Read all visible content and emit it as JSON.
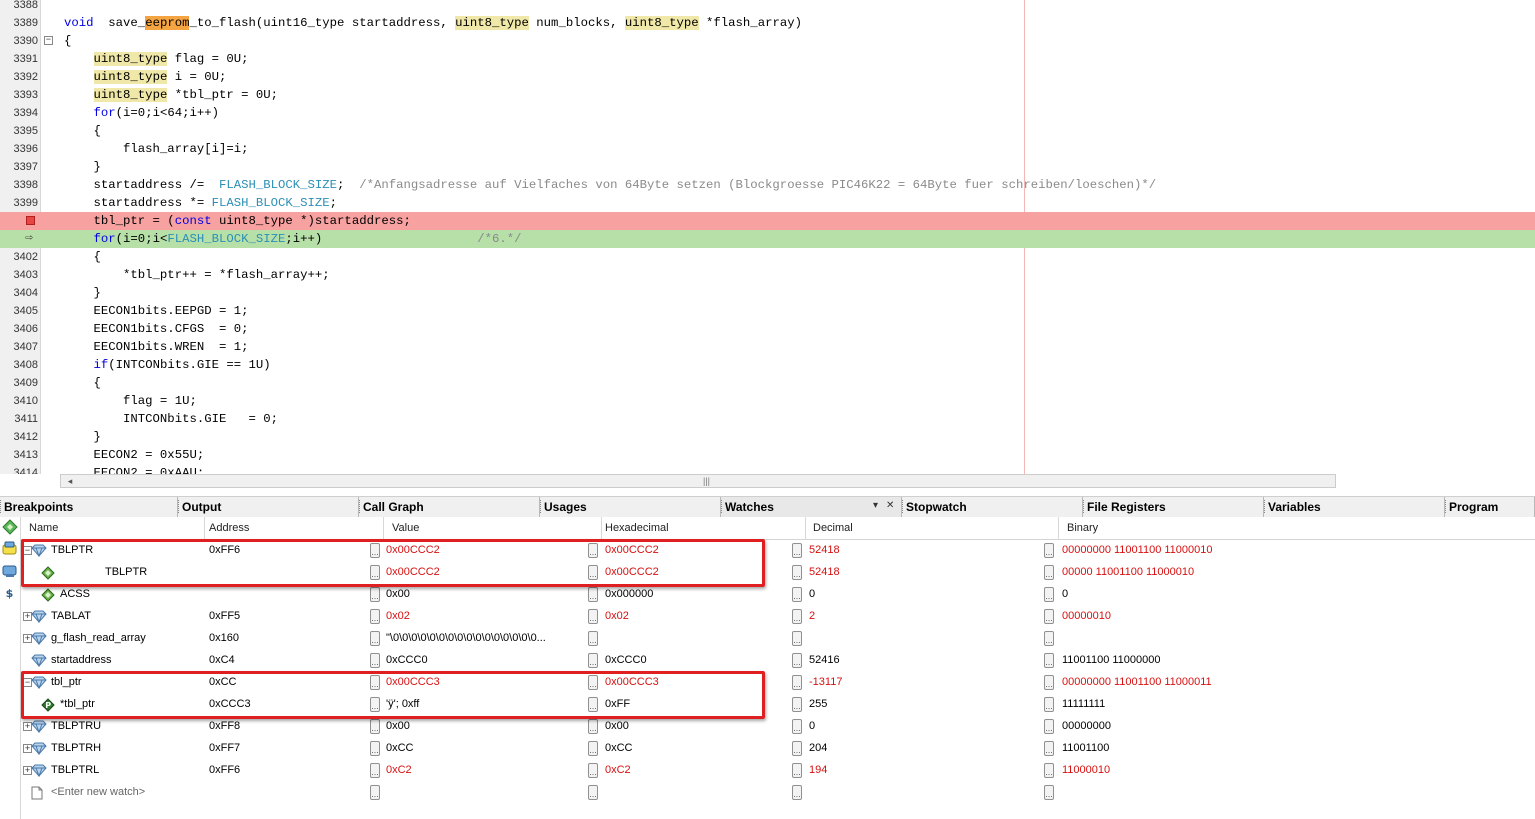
{
  "editor": {
    "lines": [
      {
        "num": "3388",
        "html": ""
      },
      {
        "num": "3389",
        "parts": [
          [
            "kw",
            "void"
          ],
          [
            "",
            "  save_"
          ],
          [
            "sel",
            "eeprom"
          ],
          [
            "",
            "_to_flash(uint16_type startaddress, "
          ],
          [
            "ty",
            "uint8_type"
          ],
          [
            "",
            " num_blocks, "
          ],
          [
            "ty",
            "uint8_type"
          ],
          [
            "",
            " *flash_array)"
          ]
        ]
      },
      {
        "num": "3390",
        "parts": [
          [
            "",
            "{"
          ]
        ],
        "fold": "−"
      },
      {
        "num": "3391",
        "parts": [
          [
            "",
            "    "
          ],
          [
            "ty",
            "uint8_type"
          ],
          [
            "",
            " flag = 0U;"
          ]
        ]
      },
      {
        "num": "3392",
        "parts": [
          [
            "",
            "    "
          ],
          [
            "ty",
            "uint8_type"
          ],
          [
            "",
            " i = 0U;"
          ]
        ]
      },
      {
        "num": "3393",
        "parts": [
          [
            "",
            "    "
          ],
          [
            "ty",
            "uint8_type"
          ],
          [
            "",
            " *tbl_ptr = 0U;"
          ]
        ]
      },
      {
        "num": "3394",
        "parts": [
          [
            "",
            "    "
          ],
          [
            "kw",
            "for"
          ],
          [
            "",
            "(i=0;i<64;i++)"
          ]
        ]
      },
      {
        "num": "3395",
        "parts": [
          [
            "",
            "    {"
          ]
        ]
      },
      {
        "num": "3396",
        "parts": [
          [
            "",
            "        flash_array[i]=i;"
          ]
        ]
      },
      {
        "num": "3397",
        "parts": [
          [
            "",
            "    }"
          ]
        ]
      },
      {
        "num": "3398",
        "parts": [
          [
            "",
            "    startaddress /=  "
          ],
          [
            "mac",
            "FLASH_BLOCK_SIZE"
          ],
          [
            "",
            ";  "
          ],
          [
            "cm",
            "/*Anfangsadresse auf Vielfaches von 64Byte setzen (Blockgroesse PIC46K22 = 64Byte fuer schreiben/loeschen)*/"
          ]
        ]
      },
      {
        "num": "3399",
        "parts": [
          [
            "",
            "    startaddress *= "
          ],
          [
            "mac",
            "FLASH_BLOCK_SIZE"
          ],
          [
            "",
            ";"
          ]
        ]
      },
      {
        "num": "",
        "kind": "bp",
        "parts": [
          [
            "",
            "    tbl_ptr = ("
          ],
          [
            "kw",
            "const"
          ],
          [
            "",
            " uint8_type *)startaddress;"
          ]
        ]
      },
      {
        "num": "",
        "kind": "cur",
        "parts": [
          [
            "",
            "    "
          ],
          [
            "kw",
            "for"
          ],
          [
            "",
            "(i=0;i<"
          ],
          [
            "mac",
            "FLASH_BLOCK_SIZE"
          ],
          [
            "",
            ";i++)                     "
          ],
          [
            "cm",
            "/*6.*/"
          ]
        ]
      },
      {
        "num": "3402",
        "parts": [
          [
            "",
            "    {"
          ]
        ]
      },
      {
        "num": "3403",
        "parts": [
          [
            "",
            "        *tbl_ptr++ = *flash_array++;"
          ]
        ]
      },
      {
        "num": "3404",
        "parts": [
          [
            "",
            "    }"
          ]
        ]
      },
      {
        "num": "3405",
        "parts": [
          [
            "",
            "    EECON1bits.EEPGD = 1;"
          ]
        ]
      },
      {
        "num": "3406",
        "parts": [
          [
            "",
            "    EECON1bits.CFGS  = 0;"
          ]
        ]
      },
      {
        "num": "3407",
        "parts": [
          [
            "",
            "    EECON1bits.WREN  = 1;"
          ]
        ]
      },
      {
        "num": "3408",
        "parts": [
          [
            "",
            "    "
          ],
          [
            "kw",
            "if"
          ],
          [
            "",
            "(INTCONbits.GIE == 1U)"
          ]
        ]
      },
      {
        "num": "3409",
        "parts": [
          [
            "",
            "    {"
          ]
        ]
      },
      {
        "num": "3410",
        "parts": [
          [
            "",
            "        flag = 1U;"
          ]
        ]
      },
      {
        "num": "3411",
        "parts": [
          [
            "",
            "        INTCONbits.GIE   = 0;"
          ]
        ]
      },
      {
        "num": "3412",
        "parts": [
          [
            "",
            "    }"
          ]
        ]
      },
      {
        "num": "3413",
        "parts": [
          [
            "",
            "    EECON2 = 0x55U;"
          ]
        ]
      },
      {
        "num": "3414",
        "parts": [
          [
            "",
            "    EECON2 = 0xAAU;"
          ]
        ]
      }
    ],
    "scroll_left_arrow": "◂",
    "scroll_grip": "|||"
  },
  "tabs": [
    {
      "label": "Breakpoints"
    },
    {
      "label": "Output"
    },
    {
      "label": "Call Graph"
    },
    {
      "label": "Usages"
    },
    {
      "label": "Watches",
      "active": true
    },
    {
      "label": "Stopwatch"
    },
    {
      "label": "File Registers"
    },
    {
      "label": "Variables"
    },
    {
      "label": "Program"
    }
  ],
  "watches": {
    "columns": [
      "Name",
      "Address",
      "Value",
      "Hexadecimal",
      "Decimal",
      "Binary"
    ],
    "rows": [
      {
        "exp": "−",
        "icon": "blue",
        "indent": 0,
        "name": "TBLPTR",
        "address": "0xFF6",
        "value": "0x00CCC2",
        "hex": "0x00CCC2",
        "dec": "52418",
        "bin": "00000000 11001100 11000010",
        "red": true
      },
      {
        "exp": "",
        "icon": "green",
        "indent": 2,
        "name": "TBLPTR",
        "address": "",
        "value": "0x00CCC2",
        "hex": "0x00CCC2",
        "dec": "52418",
        "bin": "00000 11001100 11000010",
        "red": true
      },
      {
        "exp": "",
        "icon": "green",
        "indent": 1,
        "name": "ACSS",
        "address": "",
        "value": "0x00",
        "hex": "0x000000",
        "dec": "0",
        "bin": "0",
        "red": false
      },
      {
        "exp": "+",
        "icon": "blue",
        "indent": 0,
        "name": "TABLAT",
        "address": "0xFF5",
        "value": "0x02",
        "hex": "0x02",
        "dec": "2",
        "bin": "00000010",
        "red": true
      },
      {
        "exp": "+",
        "icon": "blue",
        "indent": 0,
        "name": "g_flash_read_array",
        "address": "0x160",
        "value": "\"\\0\\0\\0\\0\\0\\0\\0\\0\\0\\0\\0\\0\\0\\0\\0\\0...",
        "hex": "",
        "dec": "",
        "bin": "",
        "red": false
      },
      {
        "exp": "",
        "icon": "blue",
        "indent": 0,
        "name": "startaddress",
        "address": "0xC4",
        "value": "0xCCC0",
        "hex": "0xCCC0",
        "dec": "52416",
        "bin": "11001100 11000000",
        "red": false
      },
      {
        "exp": "−",
        "icon": "blue",
        "indent": 0,
        "name": "tbl_ptr",
        "address": "0xCC",
        "value": "0x00CCC3",
        "hex": "0x00CCC3",
        "dec": "-13117",
        "bin": "00000000 11001100 11000011",
        "red": true
      },
      {
        "exp": "",
        "icon": "pointer",
        "indent": 1,
        "name": "*tbl_ptr",
        "address": "0xCCC3",
        "value": "'ÿ'; 0xff",
        "hex": "0xFF",
        "dec": "255",
        "bin": "11111111",
        "red": false
      },
      {
        "exp": "+",
        "icon": "blue",
        "indent": 0,
        "name": "TBLPTRU",
        "address": "0xFF8",
        "value": "0x00",
        "hex": "0x00",
        "dec": "0",
        "bin": "00000000",
        "red": false
      },
      {
        "exp": "+",
        "icon": "blue",
        "indent": 0,
        "name": "TBLPTRH",
        "address": "0xFF7",
        "value": "0xCC",
        "hex": "0xCC",
        "dec": "204",
        "bin": "11001100",
        "red": false
      },
      {
        "exp": "+",
        "icon": "blue",
        "indent": 0,
        "name": "TBLPTRL",
        "address": "0xFF6",
        "value": "0xC2",
        "hex": "0xC2",
        "dec": "194",
        "bin": "11000010",
        "red": true
      },
      {
        "exp": "",
        "icon": "new",
        "indent": 0,
        "name": "<Enter new watch>",
        "address": "",
        "value": "",
        "hex": "",
        "dec": "",
        "bin": "",
        "red": false,
        "placeholder": true
      }
    ]
  },
  "colors": {
    "highlight_box": "#e02020",
    "changed_value": "#d81010",
    "breakpoint_line": "#f7a1a1",
    "current_line": "#b6e0a8"
  }
}
